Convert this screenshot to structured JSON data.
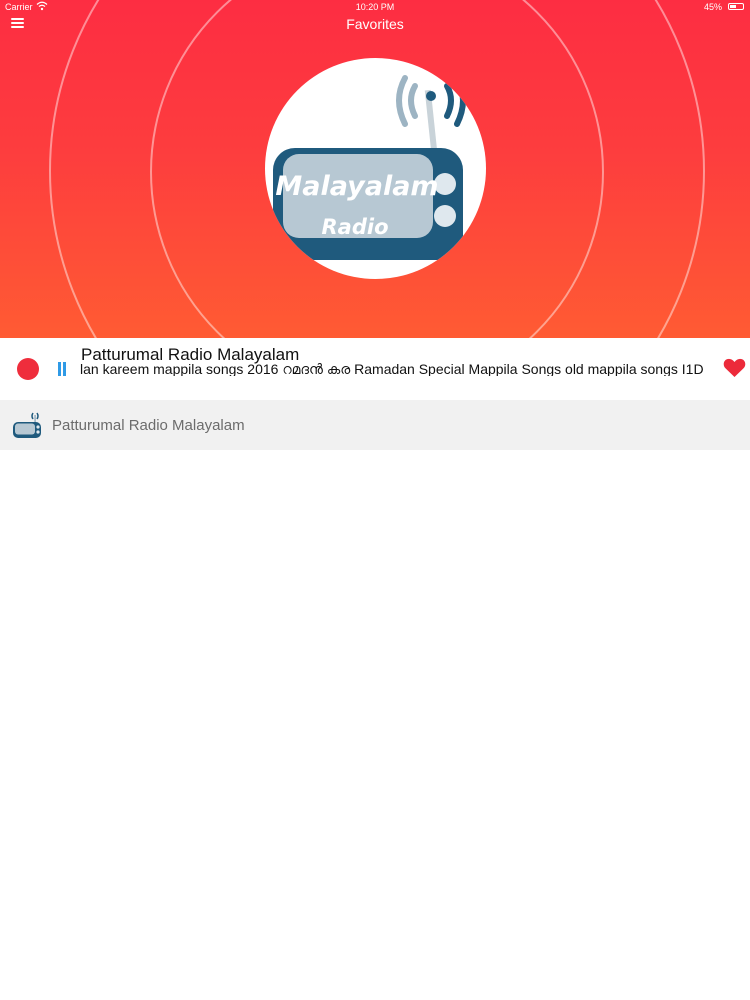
{
  "status_bar": {
    "carrier": "Carrier",
    "time": "10:20 PM",
    "battery": "45%"
  },
  "header": {
    "title": "Favorites",
    "menu_icon": "hamburger-menu-icon"
  },
  "logo": {
    "line1": "Malayalam",
    "line2": "Radio"
  },
  "player": {
    "station_name": "Patturumal Radio Malayalam",
    "now_playing": "lan kareem mappila songs 2016 റമദൻ കര Ramadan Special Mappila Songs old mappila songs I1D",
    "record_icon": "record-icon",
    "pause_icon": "pause-icon",
    "favorite_icon": "heart-icon"
  },
  "favorites_list": [
    {
      "label": "Patturumal Radio Malayalam",
      "icon": "station-thumbnail-icon"
    }
  ],
  "colors": {
    "gradient_top": "#fd2d42",
    "gradient_bottom": "#ff5b33",
    "record_red": "#ef2d3c",
    "pause_blue": "#2f9ae6",
    "heart_red": "#ec2a3a",
    "logo_navy": "#1f5a7d"
  }
}
